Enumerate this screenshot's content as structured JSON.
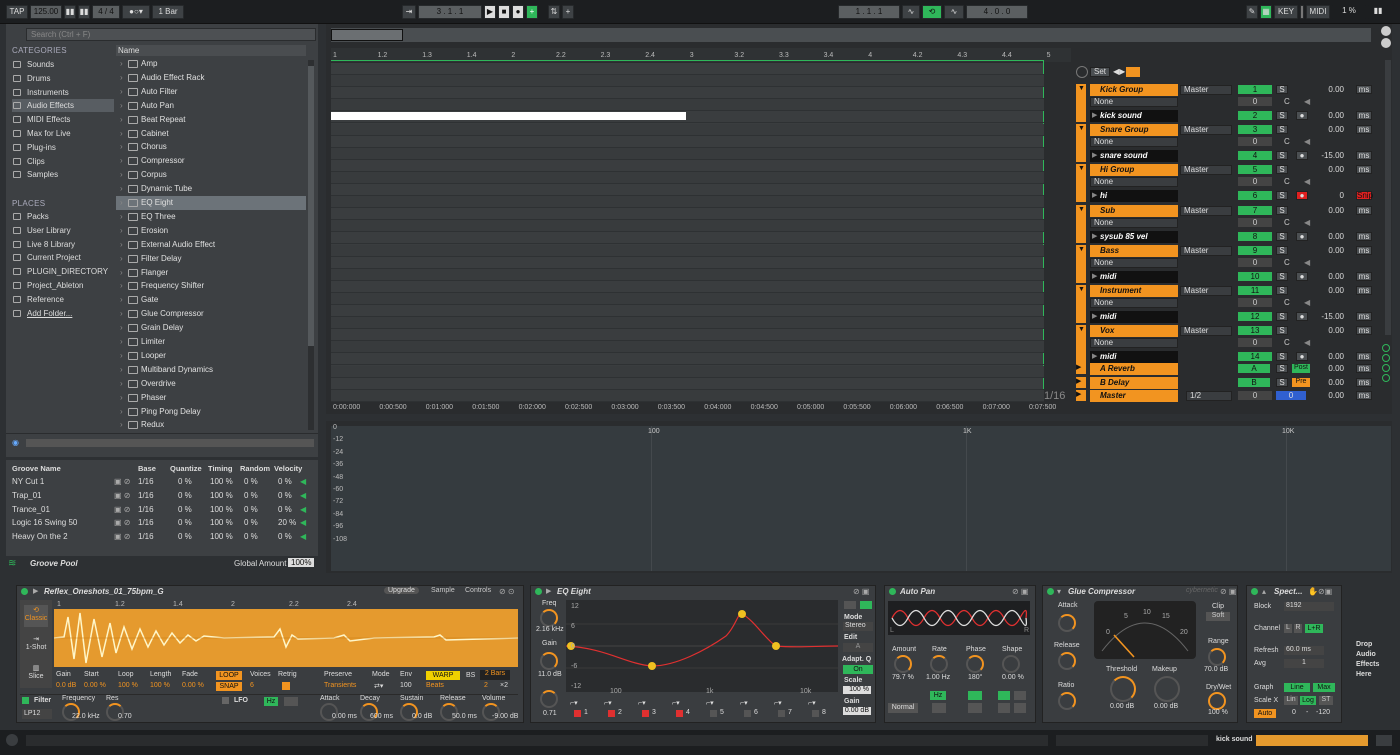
{
  "transport": {
    "tap": "TAP",
    "tempo": "125.00",
    "sig": "4 / 4",
    "quant": "1 Bar",
    "pos1": "3 .   1 .   1",
    "pos2": "1 .   1 .   1",
    "pos3": "4 .   0 .   0",
    "key": "KEY",
    "midi": "MIDI",
    "cpu": "1 %"
  },
  "browser": {
    "search_placeholder": "Search (Ctrl + F)",
    "categories_title": "CATEGORIES",
    "places_title": "PLACES",
    "name_header": "Name",
    "categories": [
      "Sounds",
      "Drums",
      "Instruments",
      "Audio Effects",
      "MIDI Effects",
      "Max for Live",
      "Plug-ins",
      "Clips",
      "Samples"
    ],
    "places": [
      "Packs",
      "User Library",
      "Live 8 Library",
      "Current Project",
      "PLUGIN_DIRECTORY",
      "Project_Ableton",
      "Reference",
      "Add Folder..."
    ],
    "items": [
      "Amp",
      "Audio Effect Rack",
      "Auto Filter",
      "Auto Pan",
      "Beat Repeat",
      "Cabinet",
      "Chorus",
      "Compressor",
      "Corpus",
      "Dynamic Tube",
      "EQ Eight",
      "EQ Three",
      "Erosion",
      "External Audio Effect",
      "Filter Delay",
      "Flanger",
      "Frequency Shifter",
      "Gate",
      "Glue Compressor",
      "Grain Delay",
      "Limiter",
      "Looper",
      "Multiband Dynamics",
      "Overdrive",
      "Phaser",
      "Ping Pong Delay",
      "Redux"
    ]
  },
  "groove": {
    "headers": [
      "Groove Name",
      "Base",
      "Quantize",
      "Timing",
      "Random",
      "Velocity"
    ],
    "rows": [
      [
        "NY Cut 1",
        "1/16",
        "0 %",
        "100 %",
        "0 %",
        "0 %"
      ],
      [
        "Trap_01",
        "1/16",
        "0 %",
        "100 %",
        "0 %",
        "0 %"
      ],
      [
        "Trance_01",
        "1/16",
        "0 %",
        "100 %",
        "0 %",
        "0 %"
      ],
      [
        "Logic 16 Swing 50",
        "1/16",
        "0 %",
        "100 %",
        "0 %",
        "20 %"
      ],
      [
        "Heavy On the 2",
        "1/16",
        "0 %",
        "100 %",
        "0 %",
        "0 %"
      ]
    ],
    "title": "Groove Pool",
    "global_label": "Global Amount",
    "global_value": "100%"
  },
  "arrangement": {
    "ruler": [
      "1",
      "1.2",
      "1.3",
      "1.4",
      "2",
      "2.2",
      "2.3",
      "2.4",
      "3",
      "3.2",
      "3.3",
      "3.4",
      "4",
      "4.2",
      "4.3",
      "4.4",
      "5"
    ],
    "times": [
      "0:00:000",
      "0:00:500",
      "0:01:000",
      "0:01:500",
      "0:02:000",
      "0:02:500",
      "0:03:000",
      "0:03:500",
      "0:04:000",
      "0:04:500",
      "0:05:000",
      "0:05:500",
      "0:06:000",
      "0:06:500",
      "0:07:000",
      "0:07:500"
    ],
    "grid": "1/16",
    "set": "Set"
  },
  "mixer": {
    "tracks": [
      {
        "name": "Kick Group",
        "out": "Master",
        "in": "None",
        "num": "1",
        "num2": "2",
        "clip": "kick sound",
        "vol": "0.00",
        "vol2": "0.00"
      },
      {
        "name": "Snare Group",
        "out": "Master",
        "in": "None",
        "num": "3",
        "num2": "4",
        "clip": "snare sound",
        "vol": "0.00",
        "vol2": "-15.00"
      },
      {
        "name": "Hi Group",
        "out": "Master",
        "in": "None",
        "num": "5",
        "num2": "6",
        "clip": "hi",
        "vol": "0.00",
        "vol2": "0"
      },
      {
        "name": "Sub",
        "out": "Master",
        "in": "None",
        "num": "7",
        "num2": "8",
        "clip": "sysub 85 vel",
        "vol": "0.00",
        "vol2": "0.00"
      },
      {
        "name": "Bass",
        "out": "Master",
        "in": "None",
        "num": "9",
        "num2": "10",
        "clip": "midi",
        "vol": "0.00",
        "vol2": "0.00"
      },
      {
        "name": "Instrument",
        "out": "Master",
        "in": "None",
        "num": "11",
        "num2": "12",
        "clip": "midi",
        "vol": "0.00",
        "vol2": "-15.00"
      },
      {
        "name": "Vox",
        "out": "Master",
        "in": "None",
        "num": "13",
        "num2": "14",
        "clip": "midi",
        "vol": "0.00",
        "vol2": "0.00"
      }
    ],
    "returns": [
      {
        "name": "A Reverb",
        "letter": "A",
        "mode": "Post",
        "vol": "0.00"
      },
      {
        "name": "B Delay",
        "letter": "B",
        "mode": "Pre",
        "vol": "0.00"
      }
    ],
    "master": {
      "name": "Master",
      "out": "1/2",
      "vol": "0.00",
      "n1": "0",
      "n2": "0"
    },
    "ms": "ms",
    "s": "S",
    "c": "C",
    "snip": "Snip"
  },
  "spectrum": {
    "freq_labels": [
      "100",
      "1K",
      "10K"
    ],
    "db_labels": [
      "0",
      "-12",
      "-24",
      "-36",
      "-48",
      "-60",
      "-72",
      "-84",
      "-96",
      "-108"
    ]
  },
  "sampler": {
    "title": "Reflex_Oneshots_01_75bpm_G",
    "upgrade": "Upgrade",
    "sample": "Sample",
    "controls": "Controls",
    "modes": [
      "Classic",
      "1-Shot",
      "Slice"
    ],
    "ruler": [
      "1",
      "1.2",
      "1.4",
      "2",
      "2.2",
      "2.4"
    ],
    "params": [
      "Gain",
      "Start",
      "Loop",
      "Length",
      "Fade",
      "Voices",
      "Retrig"
    ],
    "vals": [
      "0.0 dB",
      "0.00 %",
      "100 %",
      "100 %",
      "0.00 %",
      "6"
    ],
    "loop": "LOOP",
    "snap": "SNAP",
    "preserve": "Preserve",
    "transients": "Transients",
    "mode": "Mode",
    "env": "Env",
    "env_val": "100",
    "warp": "WARP",
    "beats": "Beats",
    "bs": "BS",
    "bars": "2 Bars",
    "two": "2",
    "x2": "×2",
    "filter": "Filter",
    "frequency": "Frequency",
    "res": "Res",
    "freq_val": "22.0 kHz",
    "res_val": "0.70",
    "lp": "LP12",
    "lfo": "LFO",
    "hz": "Hz",
    "attack": "Attack",
    "decay": "Decay",
    "sustain": "Sustain",
    "release": "Release",
    "volume": "Volume",
    "a_val": "0.00 ms",
    "d_val": "600 ms",
    "s_val": "0.0 dB",
    "r_val": "50.0 ms",
    "v_val": "-9.00 dB"
  },
  "eq": {
    "title": "EQ Eight",
    "freq": "Freq",
    "freq_val": "2.16 kHz",
    "gain": "Gain",
    "gain_val": "11.0 dB",
    "q_val": "0.71",
    "mode": "Mode",
    "stereo": "Stereo",
    "edit": "Edit",
    "a": "A",
    "adapt": "Adapt. Q",
    "on": "On",
    "scale": "Scale",
    "scale_val": "100 %",
    "gain2": "Gain",
    "gain2_val": "0.00 dB",
    "db": [
      "12",
      "6",
      "0",
      "-6",
      "-12"
    ],
    "hz": [
      "100",
      "1k",
      "10k"
    ],
    "bands": [
      "1",
      "2",
      "3",
      "4",
      "5",
      "6",
      "7",
      "8"
    ]
  },
  "autopan": {
    "title": "Auto Pan",
    "amount": "Amount",
    "rate": "Rate",
    "phase": "Phase",
    "shape": "Shape",
    "amount_val": "79.7 %",
    "rate_val": "1.00 Hz",
    "phase_val": "180°",
    "shape_val": "0.00 %",
    "normal": "Normal",
    "hz": "Hz",
    "l": "L",
    "r": "R"
  },
  "glue": {
    "title": "Glue Compressor",
    "attack": "Attack",
    "release": "Release",
    "ratio": "Ratio",
    "threshold": "Threshold",
    "makeup": "Makeup",
    "range": "Range",
    "drywet": "Dry/Wet",
    "clip": "Clip",
    "soft": "Soft",
    "t_val": "0.00 dB",
    "m_val": "0.00 dB",
    "range_val": "70.0 dB",
    "dw_val": "100 %",
    "cyberpunk": "cybernetic",
    "meter": [
      "0",
      "5",
      "10",
      "15",
      "20"
    ]
  },
  "spectrum_dev": {
    "title": "Spect...",
    "block": "Block",
    "block_val": "8192",
    "channel": "Channel",
    "l": "L",
    "r": "R",
    "lr": "L+R",
    "refresh": "Refresh",
    "refresh_val": "60.0 ms",
    "avg": "Avg",
    "avg_val": "1",
    "graph": "Graph",
    "line": "Line",
    "max": "Max",
    "scalex": "Scale X",
    "lin": "Lin",
    "log": "Log",
    "st": "ST",
    "auto": "Auto",
    "zero": "0",
    "dash": "-",
    "neg120": "-120"
  },
  "drop": "Drop Audio Effects Here",
  "status": {
    "clip": "kick sound"
  }
}
